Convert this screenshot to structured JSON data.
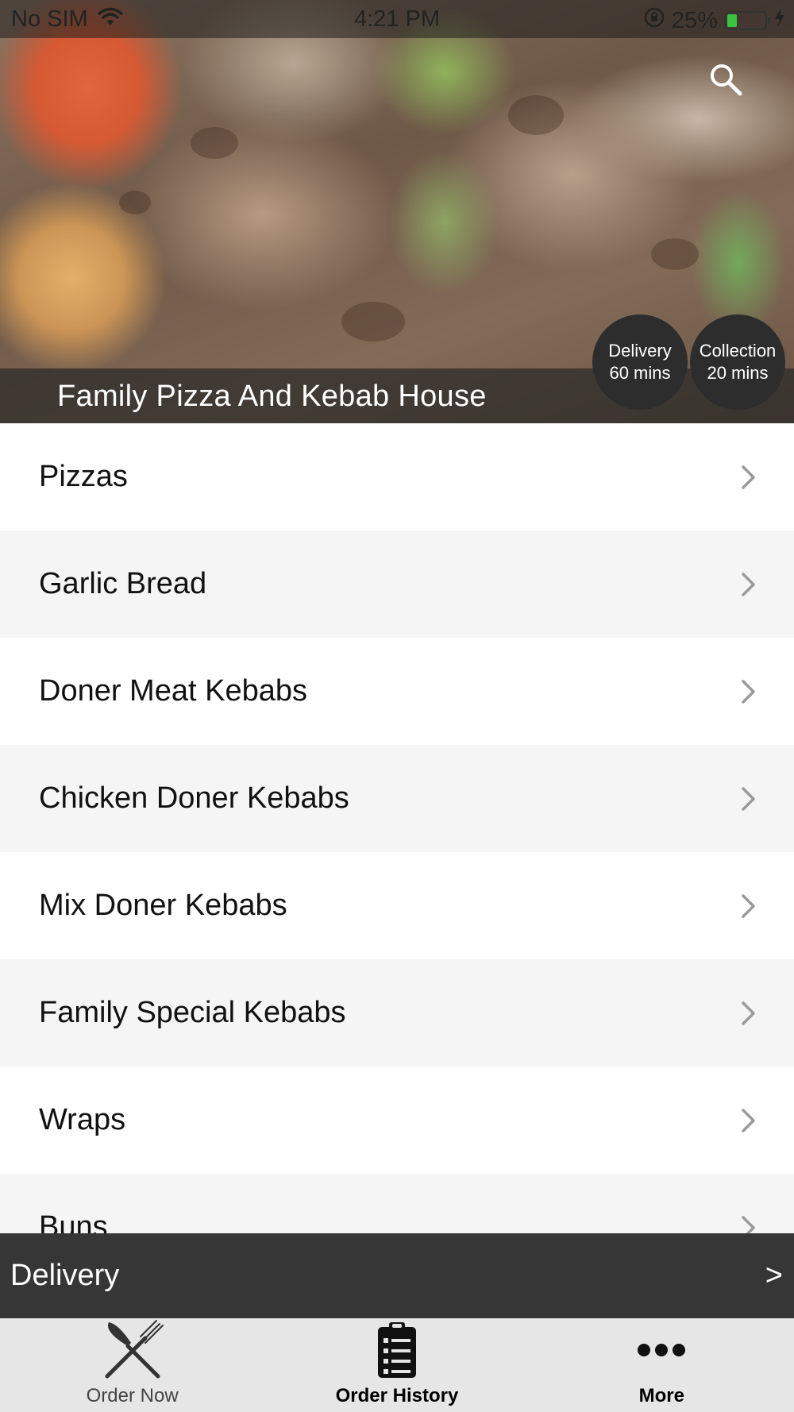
{
  "status_bar": {
    "carrier": "No SIM",
    "time": "4:21 PM",
    "battery": "25%",
    "battery_level": 0.25
  },
  "header": {
    "restaurant_name": "Family Pizza And Kebab House",
    "search_icon": "search-icon",
    "delivery_badge": {
      "label": "Delivery",
      "time": "60 mins"
    },
    "collection_badge": {
      "label": "Collection",
      "time": "20 mins"
    }
  },
  "menu": {
    "items": [
      {
        "label": "Pizzas"
      },
      {
        "label": "Garlic Bread"
      },
      {
        "label": "Doner Meat Kebabs"
      },
      {
        "label": "Chicken Doner Kebabs"
      },
      {
        "label": "Mix Doner Kebabs"
      },
      {
        "label": "Family Special Kebabs"
      },
      {
        "label": "Wraps"
      },
      {
        "label": "Buns"
      }
    ]
  },
  "delivery_bar": {
    "label": "Delivery",
    "arrow": ">"
  },
  "tab_bar": {
    "tabs": [
      {
        "label": "Order Now",
        "icon": "fork-knife-icon"
      },
      {
        "label": "Order History",
        "icon": "clipboard-list-icon"
      },
      {
        "label": "More",
        "icon": "more-dots-icon"
      }
    ],
    "active": "Order History"
  },
  "colors": {
    "band": "#363636",
    "badge": "#2d2d2d",
    "row_alt": "#f5f5f5",
    "tab_bar": "#e6e6e6",
    "battery_fill": "#3cc241"
  }
}
